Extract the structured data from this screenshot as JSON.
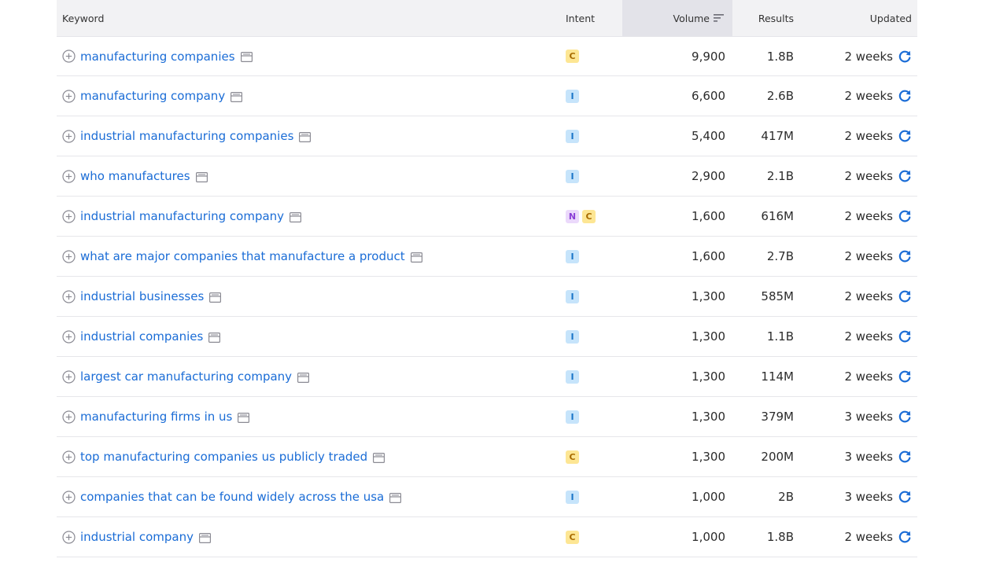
{
  "header": {
    "keyword": "Keyword",
    "intent": "Intent",
    "volume": "Volume",
    "results": "Results",
    "updated": "Updated"
  },
  "colors": {
    "link": "#1a6cd6",
    "header_bg": "#f2f2f4",
    "sorted_header_bg": "#e3e3e9",
    "intent_commercial": "#fde694",
    "intent_informational": "#c6e4fb",
    "intent_navigational": "#ebd9fb"
  },
  "rows": [
    {
      "keyword": "manufacturing companies",
      "intents": [
        "C"
      ],
      "volume": "9,900",
      "results": "1.8B",
      "updated": "2 weeks"
    },
    {
      "keyword": "manufacturing company",
      "intents": [
        "I"
      ],
      "volume": "6,600",
      "results": "2.6B",
      "updated": "2 weeks"
    },
    {
      "keyword": "industrial manufacturing companies",
      "intents": [
        "I"
      ],
      "volume": "5,400",
      "results": "417M",
      "updated": "2 weeks"
    },
    {
      "keyword": "who manufactures",
      "intents": [
        "I"
      ],
      "volume": "2,900",
      "results": "2.1B",
      "updated": "2 weeks"
    },
    {
      "keyword": "industrial manufacturing company",
      "intents": [
        "N",
        "C"
      ],
      "volume": "1,600",
      "results": "616M",
      "updated": "2 weeks"
    },
    {
      "keyword": "what are major companies that manufacture a product",
      "intents": [
        "I"
      ],
      "volume": "1,600",
      "results": "2.7B",
      "updated": "2 weeks"
    },
    {
      "keyword": "industrial businesses",
      "intents": [
        "I"
      ],
      "volume": "1,300",
      "results": "585M",
      "updated": "2 weeks"
    },
    {
      "keyword": "industrial companies",
      "intents": [
        "I"
      ],
      "volume": "1,300",
      "results": "1.1B",
      "updated": "2 weeks"
    },
    {
      "keyword": "largest car manufacturing company",
      "intents": [
        "I"
      ],
      "volume": "1,300",
      "results": "114M",
      "updated": "2 weeks"
    },
    {
      "keyword": "manufacturing firms in us",
      "intents": [
        "I"
      ],
      "volume": "1,300",
      "results": "379M",
      "updated": "3 weeks"
    },
    {
      "keyword": "top manufacturing companies us publicly traded",
      "intents": [
        "C"
      ],
      "volume": "1,300",
      "results": "200M",
      "updated": "3 weeks"
    },
    {
      "keyword": "companies that can be found widely across the usa",
      "intents": [
        "I"
      ],
      "volume": "1,000",
      "results": "2B",
      "updated": "3 weeks"
    },
    {
      "keyword": "industrial company",
      "intents": [
        "C"
      ],
      "volume": "1,000",
      "results": "1.8B",
      "updated": "2 weeks"
    }
  ],
  "icons": {
    "add": "plus-circle-icon",
    "serp": "serp-features-icon",
    "refresh": "refresh-icon",
    "sort": "sort-descending-icon"
  }
}
